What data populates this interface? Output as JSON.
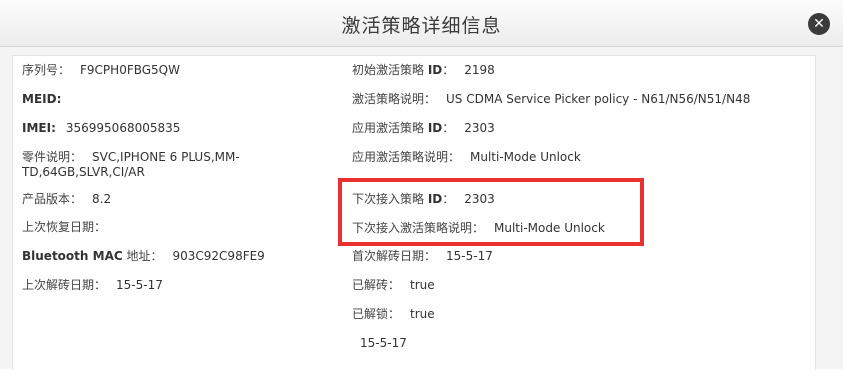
{
  "dialog": {
    "title": "激活策略详细信息"
  },
  "left": {
    "serial": {
      "label": "序列号：",
      "value": "F9CPH0FBG5QW"
    },
    "meid": {
      "label": "MEID:",
      "value": ""
    },
    "imei": {
      "label": "IMEI:",
      "value": "356995068005835"
    },
    "part": {
      "label": "零件说明：",
      "value": "SVC,IPHONE 6 PLUS,MM-",
      "value2": "TD,64GB,SLVR,CI/AR"
    },
    "version": {
      "label": "产品版本：",
      "value": "8.2"
    },
    "last_restore": {
      "label": "上次恢复日期：",
      "value": ""
    },
    "bt": {
      "label_bold": "Bluetooth MAC",
      "label": " 地址：",
      "value": "903C92C98FE9"
    },
    "last_unlock": {
      "label": "上次解砖日期：",
      "value": "15-5-17"
    }
  },
  "right": {
    "initial_policy": {
      "label": "初始激活策略 ",
      "label_bold": "ID",
      "label_end": "：",
      "value": "2198"
    },
    "policy_desc": {
      "label": "激活策略说明：",
      "value": "US CDMA Service Picker policy - N61/N56/N51/N48"
    },
    "applied_policy": {
      "label": "应用激活策略 ",
      "label_bold": "ID",
      "label_end": "：",
      "value": "2303"
    },
    "applied_desc": {
      "label": "应用激活策略说明：",
      "value": "Multi-Mode Unlock"
    },
    "next_policy": {
      "label": "下次接入策略 ",
      "label_bold": "ID",
      "label_end": "：",
      "value": "2303"
    },
    "next_desc": {
      "label": "下次接入激活策略说明：",
      "value": "Multi-Mode Unlock"
    },
    "first_unlock": {
      "label": "首次解砖日期：",
      "value": "15-5-17"
    },
    "unbricked": {
      "label": "已解砖：",
      "value": "true"
    },
    "unlocked": {
      "label": "已解锁：",
      "value": "true"
    },
    "date_extra": {
      "value": "15-5-17"
    }
  },
  "colors": {
    "highlight": "#e8322f",
    "close_button": "#3b3b3b"
  },
  "icons": {
    "close": "close-circle-icon"
  }
}
